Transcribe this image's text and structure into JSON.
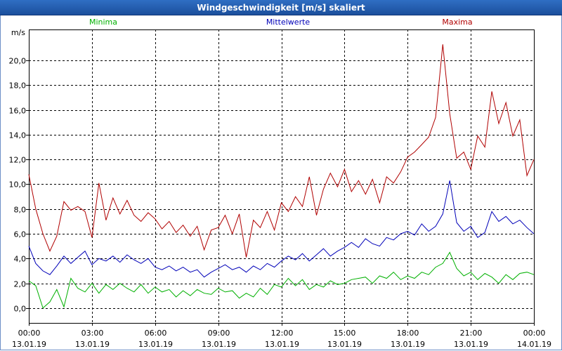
{
  "window": {
    "title": "Windgeschwindigkeit [m/s] skaliert"
  },
  "colors": {
    "minima": "#00b000",
    "mittel": "#0000b8",
    "maxima": "#b00000",
    "grid": "#000000"
  },
  "chart_data": {
    "type": "line",
    "title": "Windgeschwindigkeit [m/s] skaliert",
    "ylabel": "m/s",
    "xlabel": "",
    "ylim": [
      -1.2,
      22.5
    ],
    "yticks": [
      "0,0",
      "2,0",
      "4,0",
      "6,0",
      "8,0",
      "10,0",
      "12,0",
      "14,0",
      "16,0",
      "18,0",
      "20,0"
    ],
    "ytick_values": [
      0,
      2,
      4,
      6,
      8,
      10,
      12,
      14,
      16,
      18,
      20
    ],
    "xticks": [
      {
        "time": "00:00",
        "date": "13.01.19"
      },
      {
        "time": "03:00",
        "date": "13.01.19"
      },
      {
        "time": "06:00",
        "date": "13.01.19"
      },
      {
        "time": "09:00",
        "date": "13.01.19"
      },
      {
        "time": "12:00",
        "date": "13.01.19"
      },
      {
        "time": "15:00",
        "date": "13.01.19"
      },
      {
        "time": "18:00",
        "date": "13.01.19"
      },
      {
        "time": "21:00",
        "date": "13.01.19"
      },
      {
        "time": "00:00",
        "date": "14.01.19"
      }
    ],
    "x_range_hours": [
      0,
      24
    ],
    "grid": true,
    "legend_position": "top",
    "series": [
      {
        "name": "Minima",
        "color": "#00b000",
        "x": [
          0,
          0.33,
          0.67,
          1,
          1.33,
          1.67,
          2,
          2.33,
          2.67,
          3,
          3.33,
          3.67,
          4,
          4.33,
          4.67,
          5,
          5.33,
          5.67,
          6,
          6.33,
          6.67,
          7,
          7.33,
          7.67,
          8,
          8.33,
          8.67,
          9,
          9.33,
          9.67,
          10,
          10.33,
          10.67,
          11,
          11.33,
          11.67,
          12,
          12.33,
          12.67,
          13,
          13.33,
          13.67,
          14,
          14.33,
          14.67,
          15,
          15.33,
          15.67,
          16,
          16.33,
          16.67,
          17,
          17.33,
          17.67,
          18,
          18.33,
          18.67,
          19,
          19.33,
          19.67,
          20,
          20.33,
          20.67,
          21,
          21.33,
          21.67,
          22,
          22.33,
          22.67,
          23,
          23.33,
          23.67,
          24
        ],
        "values": [
          2.2,
          1.8,
          0.0,
          0.5,
          1.5,
          0.1,
          2.4,
          1.6,
          1.3,
          2.0,
          1.2,
          1.9,
          1.5,
          2.0,
          1.6,
          1.3,
          1.9,
          1.2,
          1.7,
          1.3,
          1.5,
          0.9,
          1.4,
          1.0,
          1.5,
          1.2,
          1.1,
          1.6,
          1.3,
          1.4,
          0.8,
          1.2,
          0.9,
          1.6,
          1.1,
          1.9,
          1.7,
          2.4,
          1.8,
          2.3,
          1.5,
          1.9,
          1.7,
          2.2,
          1.9,
          2.0,
          2.3,
          2.4,
          2.5,
          2.0,
          2.6,
          2.4,
          2.9,
          2.3,
          2.6,
          2.4,
          2.9,
          2.7,
          3.3,
          3.6,
          4.5,
          3.2,
          2.6,
          2.9,
          2.3,
          2.8,
          2.5,
          2.0,
          2.7,
          2.3,
          2.8,
          2.9,
          2.7
        ]
      },
      {
        "name": "Mittelwerte",
        "color": "#0000b8",
        "x": [
          0,
          0.33,
          0.67,
          1,
          1.33,
          1.67,
          2,
          2.33,
          2.67,
          3,
          3.33,
          3.67,
          4,
          4.33,
          4.67,
          5,
          5.33,
          5.67,
          6,
          6.33,
          6.67,
          7,
          7.33,
          7.67,
          8,
          8.33,
          8.67,
          9,
          9.33,
          9.67,
          10,
          10.33,
          10.67,
          11,
          11.33,
          11.67,
          12,
          12.33,
          12.67,
          13,
          13.33,
          13.67,
          14,
          14.33,
          14.67,
          15,
          15.33,
          15.67,
          16,
          16.33,
          16.67,
          17,
          17.33,
          17.67,
          18,
          18.33,
          18.67,
          19,
          19.33,
          19.67,
          20,
          20.33,
          20.67,
          21,
          21.33,
          21.67,
          22,
          22.33,
          22.67,
          23,
          23.33,
          23.67,
          24
        ],
        "values": [
          5.0,
          3.6,
          3.0,
          2.7,
          3.4,
          4.2,
          3.6,
          4.1,
          4.6,
          3.5,
          4.0,
          3.8,
          4.2,
          3.7,
          4.3,
          3.9,
          3.6,
          4.0,
          3.3,
          3.1,
          3.4,
          3.0,
          3.3,
          2.9,
          3.1,
          2.5,
          2.9,
          3.2,
          3.5,
          3.1,
          3.3,
          2.9,
          3.4,
          3.1,
          3.6,
          3.3,
          3.8,
          4.2,
          3.9,
          4.4,
          3.8,
          4.3,
          4.8,
          4.2,
          4.6,
          4.9,
          5.3,
          4.9,
          5.6,
          5.2,
          5.0,
          5.7,
          5.5,
          6.0,
          6.2,
          5.9,
          6.8,
          6.2,
          6.6,
          7.6,
          10.3,
          6.9,
          6.2,
          6.6,
          5.7,
          6.1,
          7.8,
          7.0,
          7.4,
          6.8,
          7.1,
          6.5,
          6.0
        ]
      },
      {
        "name": "Maxima",
        "color": "#b00000",
        "x": [
          0,
          0.33,
          0.67,
          1,
          1.33,
          1.67,
          2,
          2.33,
          2.67,
          3,
          3.33,
          3.67,
          4,
          4.33,
          4.67,
          5,
          5.33,
          5.67,
          6,
          6.33,
          6.67,
          7,
          7.33,
          7.67,
          8,
          8.33,
          8.67,
          9,
          9.33,
          9.67,
          10,
          10.33,
          10.67,
          11,
          11.33,
          11.67,
          12,
          12.33,
          12.67,
          13,
          13.33,
          13.67,
          14,
          14.33,
          14.67,
          15,
          15.33,
          15.67,
          16,
          16.33,
          16.67,
          17,
          17.33,
          17.67,
          18,
          18.33,
          18.67,
          19,
          19.33,
          19.67,
          20,
          20.33,
          20.67,
          21,
          21.33,
          21.67,
          22,
          22.33,
          22.67,
          23,
          23.33,
          23.67,
          24
        ],
        "values": [
          10.8,
          8.0,
          6.0,
          4.6,
          5.8,
          8.6,
          7.9,
          8.2,
          7.8,
          5.7,
          10.1,
          7.1,
          8.9,
          7.6,
          8.7,
          7.5,
          7.0,
          7.7,
          7.2,
          6.4,
          7.0,
          6.1,
          6.7,
          5.8,
          6.6,
          4.7,
          6.3,
          6.5,
          7.5,
          6.0,
          7.6,
          4.1,
          7.1,
          6.5,
          7.8,
          6.3,
          8.5,
          7.8,
          9.0,
          8.2,
          10.6,
          7.5,
          9.6,
          10.9,
          9.8,
          11.2,
          9.4,
          10.3,
          9.2,
          10.4,
          8.5,
          10.6,
          10.1,
          11.0,
          12.2,
          12.6,
          13.2,
          13.8,
          15.4,
          21.3,
          15.7,
          12.1,
          12.6,
          11.2,
          13.9,
          13.0,
          17.5,
          14.9,
          16.6,
          13.9,
          15.2,
          10.7,
          12.0
        ]
      }
    ]
  }
}
